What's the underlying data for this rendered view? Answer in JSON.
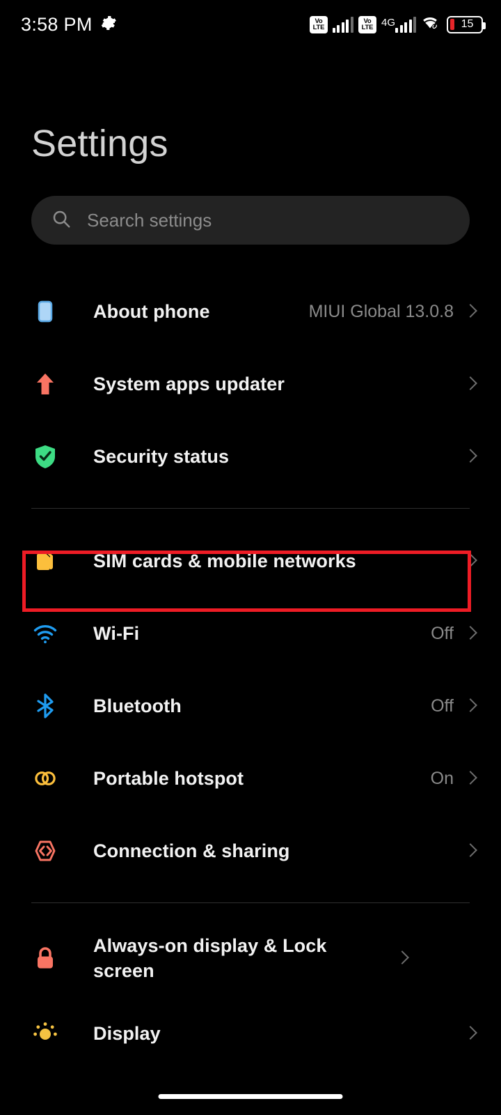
{
  "status_bar": {
    "time": "3:58 PM",
    "gear_icon": "gear-icon",
    "volte_top": "Vo",
    "volte_bottom": "LTE",
    "network_label": "4G",
    "wifi_icon": "wifi-link-icon",
    "battery_level": "15"
  },
  "header": {
    "title": "Settings"
  },
  "search": {
    "icon": "search-icon",
    "placeholder": "Search settings",
    "value": ""
  },
  "groups": [
    {
      "id": "system-group",
      "items": [
        {
          "icon": "phone-icon",
          "label": "About phone",
          "value": "MIUI Global 13.0.8",
          "icon_color": "#aed6f7"
        },
        {
          "icon": "arrow-up-icon",
          "label": "System apps updater",
          "value": "",
          "icon_color": "#f97463"
        },
        {
          "icon": "shield-check-icon",
          "label": "Security status",
          "value": "",
          "icon_color": "#3ddc84"
        }
      ]
    },
    {
      "id": "connectivity-group",
      "items": [
        {
          "icon": "sim-cards-icon",
          "label": "SIM cards & mobile networks",
          "value": "",
          "icon_color": "#fcbf3c",
          "highlighted": true
        },
        {
          "icon": "wifi-icon",
          "label": "Wi-Fi",
          "value": "Off",
          "icon_color": "#1f9cf0"
        },
        {
          "icon": "bluetooth-icon",
          "label": "Bluetooth",
          "value": "Off",
          "icon_color": "#1f9cf0"
        },
        {
          "icon": "hotspot-icon",
          "label": "Portable hotspot",
          "value": "On",
          "icon_color": "#fcbf3c"
        },
        {
          "icon": "connection-share-icon",
          "label": "Connection & sharing",
          "value": "",
          "icon_color": "#f97463"
        }
      ]
    },
    {
      "id": "display-group",
      "items": [
        {
          "icon": "lock-icon",
          "label": "Always-on display & Lock screen",
          "value": "",
          "icon_color": "#f97463"
        },
        {
          "icon": "sun-icon",
          "label": "Display",
          "value": "",
          "icon_color": "#f5c242"
        }
      ]
    }
  ],
  "highlight": {
    "color": "#ee1c25",
    "target": "SIM cards & mobile networks"
  },
  "home_indicator": "home-indicator"
}
